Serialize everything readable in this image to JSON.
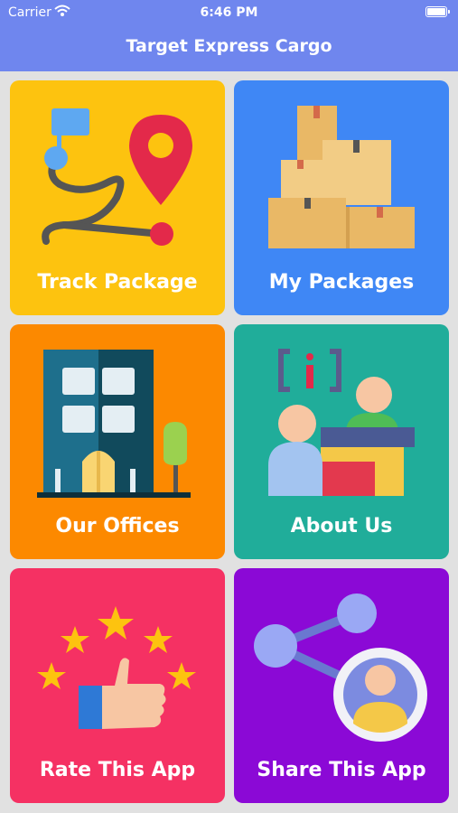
{
  "status_bar": {
    "carrier": "Carrier",
    "time": "6:46 PM"
  },
  "header": {
    "title": "Target Express Cargo"
  },
  "tiles": [
    {
      "label": "Track Package",
      "color": "#fdc30f",
      "icon": "route-map-pin-icon"
    },
    {
      "label": "My Packages",
      "color": "#3f87f5",
      "icon": "packages-icon"
    },
    {
      "label": "Our Offices",
      "color": "#fc8900",
      "icon": "office-building-icon"
    },
    {
      "label": "About Us",
      "color": "#20ad9a",
      "icon": "info-desk-icon"
    },
    {
      "label": "Rate This App",
      "color": "#f53163",
      "icon": "thumbs-up-stars-icon"
    },
    {
      "label": "Share This App",
      "color": "#8b09d6",
      "icon": "share-network-icon"
    }
  ]
}
